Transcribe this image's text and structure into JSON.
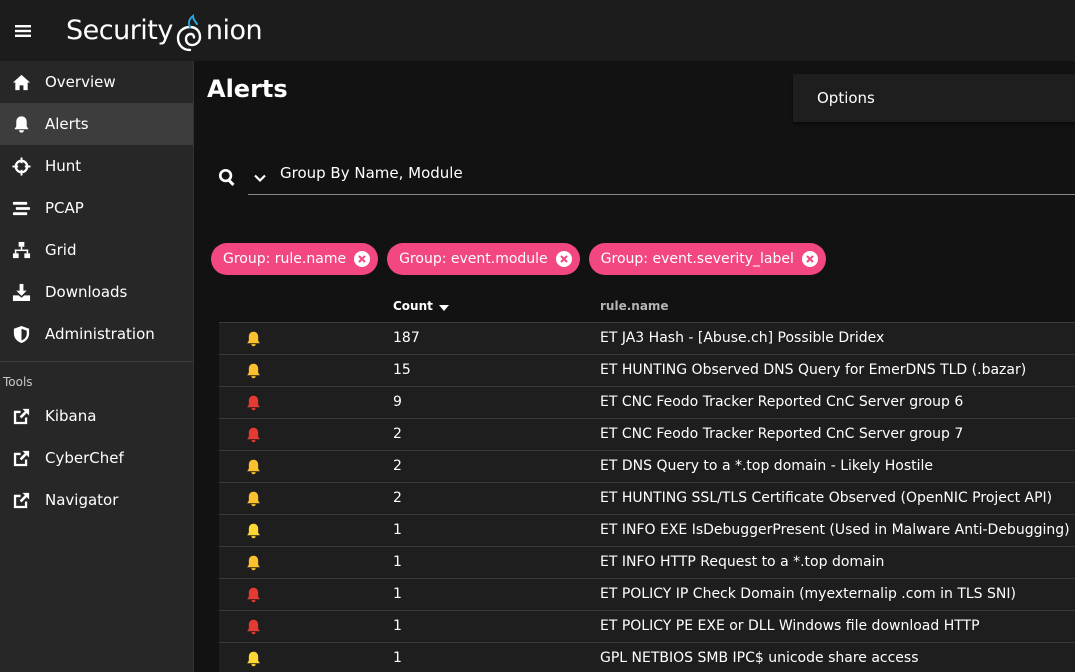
{
  "app": {
    "logo_text_a": "Security",
    "logo_text_b": "nion"
  },
  "colors": {
    "chip": "#f24781",
    "severity_high": "#e53935",
    "severity_medium": "#fbc02d",
    "severity_low": "#fdd835"
  },
  "sidebar": {
    "items": [
      {
        "label": "Overview",
        "icon": "home-icon"
      },
      {
        "label": "Alerts",
        "icon": "bell-icon",
        "active": true
      },
      {
        "label": "Hunt",
        "icon": "crosshairs-icon"
      },
      {
        "label": "PCAP",
        "icon": "stream-icon"
      },
      {
        "label": "Grid",
        "icon": "network-icon"
      },
      {
        "label": "Downloads",
        "icon": "download-icon"
      },
      {
        "label": "Administration",
        "icon": "shield-icon"
      }
    ],
    "tools_label": "Tools",
    "tools": [
      {
        "label": "Kibana",
        "icon": "external-link-icon"
      },
      {
        "label": "CyberChef",
        "icon": "external-link-icon"
      },
      {
        "label": "Navigator",
        "icon": "external-link-icon"
      }
    ]
  },
  "main": {
    "title": "Alerts",
    "options_label": "Options",
    "query": "Group By Name, Module",
    "chips": [
      "Group: rule.name",
      "Group: event.module",
      "Group: event.severity_label"
    ],
    "table": {
      "headers": {
        "count": "Count",
        "name": "rule.name"
      },
      "rows": [
        {
          "severity": "medium",
          "count": "187",
          "name": "ET JA3 Hash - [Abuse.ch] Possible Dridex"
        },
        {
          "severity": "medium",
          "count": "15",
          "name": "ET HUNTING Observed DNS Query for EmerDNS TLD (.bazar)"
        },
        {
          "severity": "high",
          "count": "9",
          "name": "ET CNC Feodo Tracker Reported CnC Server group 6"
        },
        {
          "severity": "high",
          "count": "2",
          "name": "ET CNC Feodo Tracker Reported CnC Server group 7"
        },
        {
          "severity": "medium",
          "count": "2",
          "name": "ET DNS Query to a *.top domain - Likely Hostile"
        },
        {
          "severity": "medium",
          "count": "2",
          "name": "ET HUNTING SSL/TLS Certificate Observed (OpenNIC Project API)"
        },
        {
          "severity": "low",
          "count": "1",
          "name": "ET INFO EXE IsDebuggerPresent (Used in Malware Anti-Debugging)"
        },
        {
          "severity": "medium",
          "count": "1",
          "name": "ET INFO HTTP Request to a *.top domain"
        },
        {
          "severity": "high",
          "count": "1",
          "name": "ET POLICY IP Check Domain (myexternalip .com in TLS SNI)"
        },
        {
          "severity": "high",
          "count": "1",
          "name": "ET POLICY PE EXE or DLL Windows file download HTTP"
        },
        {
          "severity": "low",
          "count": "1",
          "name": "GPL NETBIOS SMB IPC$ unicode share access"
        }
      ]
    }
  }
}
